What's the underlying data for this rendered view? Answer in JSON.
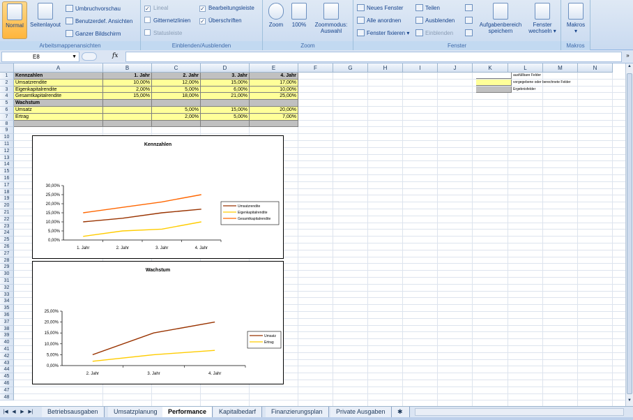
{
  "ribbon": {
    "workbook_views": {
      "label": "Arbeitsmappenansichten",
      "normal": "Normal",
      "page_layout": "Seitenlayout",
      "page_break": "Umbruchvorschau",
      "custom_views": "Benutzerdef. Ansichten",
      "full_screen": "Ganzer Bildschirm"
    },
    "show_hide": {
      "label": "Einblenden/Ausblenden",
      "ruler": "Lineal",
      "gridlines": "Gitternetzlinien",
      "messagebar": "Statusleiste",
      "formula_bar": "Bearbeitungsleiste",
      "headings": "Überschriften"
    },
    "zoom": {
      "label": "Zoom",
      "zoom": "Zoom",
      "hundred": "100%",
      "to_selection_1": "Zoommodus:",
      "to_selection_2": "Auswahl"
    },
    "window": {
      "label": "Fenster",
      "new_window": "Neues Fenster",
      "arrange_all": "Alle anordnen",
      "freeze": "Fenster fixieren",
      "split": "Teilen",
      "hide": "Ausblenden",
      "unhide": "Einblenden",
      "save_workspace_1": "Aufgabenbereich",
      "save_workspace_2": "speichern",
      "switch_windows_1": "Fenster",
      "switch_windows_2": "wechseln"
    },
    "macros": {
      "label": "Makros",
      "button": "Makros"
    }
  },
  "formula_bar": {
    "name_box": "E8",
    "fx": "fx",
    "formula": ""
  },
  "columns": [
    "A",
    "B",
    "C",
    "D",
    "E",
    "F",
    "G",
    "H",
    "I",
    "J",
    "K",
    "L",
    "M",
    "N"
  ],
  "rows": [
    "1",
    "2",
    "3",
    "4",
    "5",
    "6",
    "7",
    "8",
    "9",
    "10",
    "11",
    "12",
    "13",
    "14",
    "15",
    "16",
    "17",
    "18",
    "19",
    "20",
    "21",
    "22",
    "23",
    "24",
    "25",
    "26",
    "27",
    "28",
    "29",
    "30",
    "31",
    "32",
    "33",
    "34",
    "35",
    "36",
    "37",
    "38",
    "39",
    "40",
    "41",
    "42",
    "43",
    "44",
    "45",
    "46",
    "47",
    "48"
  ],
  "table": {
    "header": [
      "Kennzahlen",
      "1. Jahr",
      "2. Jahr",
      "3. Jahr",
      "4. Jahr"
    ],
    "kennzahlen": [
      [
        "Umsatzrendite",
        "10,00%",
        "12,00%",
        "15,00%",
        "17,00%"
      ],
      [
        "Eigenkapitalrendite",
        "2,00%",
        "5,00%",
        "6,00%",
        "10,00%"
      ],
      [
        "Gesamtkapitalrendite",
        "15,00%",
        "18,00%",
        "21,00%",
        "25,00%"
      ]
    ],
    "wachstum_label": "Wachstum",
    "wachstum": [
      [
        "Umsatz",
        "",
        "5,00%",
        "15,00%",
        "20,00%"
      ],
      [
        "Ertrag",
        "",
        "2,00%",
        "5,00%",
        "7,00%"
      ]
    ]
  },
  "legend_box": {
    "fillable": "ausfüllbare Felder",
    "preset": "vorgegebene oder berechnete Felder",
    "result": "Ergebnisfelder"
  },
  "chart_data": [
    {
      "type": "line",
      "title": "Kennzahlen",
      "categories": [
        "1. Jahr",
        "2. Jahr",
        "3. Jahr",
        "4. Jahr"
      ],
      "ylim": [
        0,
        30
      ],
      "yticks": [
        "0,00%",
        "5,00%",
        "10,00%",
        "15,00%",
        "20,00%",
        "25,00%",
        "30,00%"
      ],
      "legend": "right",
      "series": [
        {
          "name": "Umsatzrendite",
          "values": [
            10,
            12,
            15,
            17
          ],
          "color": "#993300"
        },
        {
          "name": "Eigenkapitalrendite",
          "values": [
            2,
            5,
            6,
            10
          ],
          "color": "#ffcc00"
        },
        {
          "name": "Gesamtkapitalrendite",
          "values": [
            15,
            18,
            21,
            25
          ],
          "color": "#ff6600"
        }
      ]
    },
    {
      "type": "line",
      "title": "Wachstum",
      "categories": [
        "2. Jahr",
        "3. Jahr",
        "4. Jahr"
      ],
      "ylim": [
        0,
        25
      ],
      "yticks": [
        "0,00%",
        "5,00%",
        "10,00%",
        "15,00%",
        "20,00%",
        "25,00%"
      ],
      "legend": "right",
      "series": [
        {
          "name": "Umsatz",
          "values": [
            5,
            15,
            20
          ],
          "color": "#993300"
        },
        {
          "name": "Ertrag",
          "values": [
            2,
            5,
            7
          ],
          "color": "#ffcc00"
        }
      ]
    }
  ],
  "sheet_tabs": [
    "Betriebsausgaben",
    "Umsatzplanung",
    "Performance",
    "Kapitalbedarf",
    "Finanzierungsplan",
    "Private Ausgaben"
  ],
  "active_tab": "Performance"
}
